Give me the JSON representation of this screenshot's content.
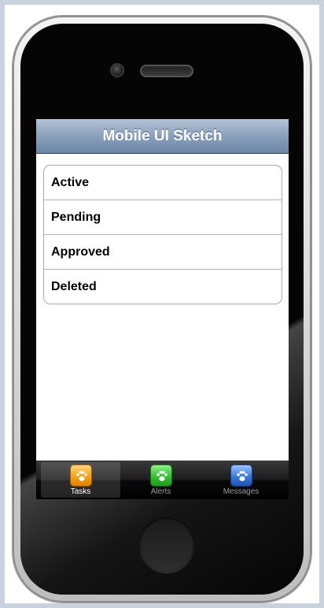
{
  "navbar": {
    "title": "Mobile UI Sketch"
  },
  "list": {
    "items": [
      {
        "label": "Active"
      },
      {
        "label": "Pending"
      },
      {
        "label": "Approved"
      },
      {
        "label": "Deleted"
      }
    ]
  },
  "tabbar": {
    "selected": "Tasks",
    "tabs": [
      {
        "label": "Tasks",
        "icon": "paw-icon",
        "color": "#f5a21a"
      },
      {
        "label": "Alerts",
        "icon": "paw-icon",
        "color": "#36c032"
      },
      {
        "label": "Messages",
        "icon": "paw-icon",
        "color": "#3a78dc"
      }
    ]
  },
  "colors": {
    "navbar": "#8aa0bc",
    "tabbar": "#1c1c1c",
    "phone_body": "#050505"
  }
}
